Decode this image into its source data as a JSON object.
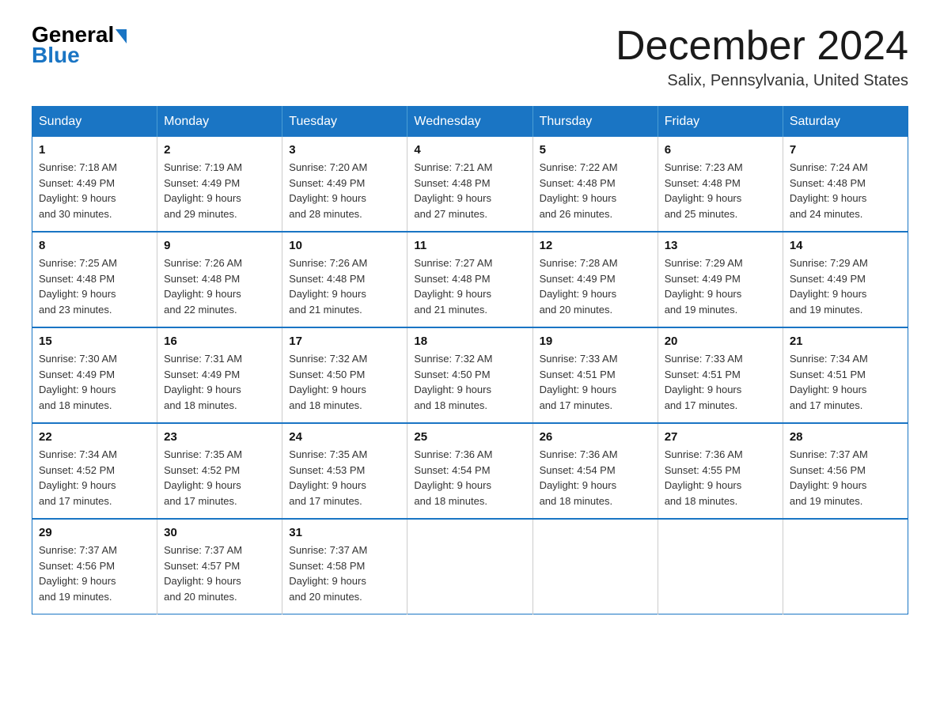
{
  "header": {
    "logo_general": "General",
    "logo_blue": "Blue",
    "month_title": "December 2024",
    "location": "Salix, Pennsylvania, United States"
  },
  "weekdays": [
    "Sunday",
    "Monday",
    "Tuesday",
    "Wednesday",
    "Thursday",
    "Friday",
    "Saturday"
  ],
  "weeks": [
    [
      {
        "day": "1",
        "sunrise": "7:18 AM",
        "sunset": "4:49 PM",
        "daylight": "9 hours and 30 minutes."
      },
      {
        "day": "2",
        "sunrise": "7:19 AM",
        "sunset": "4:49 PM",
        "daylight": "9 hours and 29 minutes."
      },
      {
        "day": "3",
        "sunrise": "7:20 AM",
        "sunset": "4:49 PM",
        "daylight": "9 hours and 28 minutes."
      },
      {
        "day": "4",
        "sunrise": "7:21 AM",
        "sunset": "4:48 PM",
        "daylight": "9 hours and 27 minutes."
      },
      {
        "day": "5",
        "sunrise": "7:22 AM",
        "sunset": "4:48 PM",
        "daylight": "9 hours and 26 minutes."
      },
      {
        "day": "6",
        "sunrise": "7:23 AM",
        "sunset": "4:48 PM",
        "daylight": "9 hours and 25 minutes."
      },
      {
        "day": "7",
        "sunrise": "7:24 AM",
        "sunset": "4:48 PM",
        "daylight": "9 hours and 24 minutes."
      }
    ],
    [
      {
        "day": "8",
        "sunrise": "7:25 AM",
        "sunset": "4:48 PM",
        "daylight": "9 hours and 23 minutes."
      },
      {
        "day": "9",
        "sunrise": "7:26 AM",
        "sunset": "4:48 PM",
        "daylight": "9 hours and 22 minutes."
      },
      {
        "day": "10",
        "sunrise": "7:26 AM",
        "sunset": "4:48 PM",
        "daylight": "9 hours and 21 minutes."
      },
      {
        "day": "11",
        "sunrise": "7:27 AM",
        "sunset": "4:48 PM",
        "daylight": "9 hours and 21 minutes."
      },
      {
        "day": "12",
        "sunrise": "7:28 AM",
        "sunset": "4:49 PM",
        "daylight": "9 hours and 20 minutes."
      },
      {
        "day": "13",
        "sunrise": "7:29 AM",
        "sunset": "4:49 PM",
        "daylight": "9 hours and 19 minutes."
      },
      {
        "day": "14",
        "sunrise": "7:29 AM",
        "sunset": "4:49 PM",
        "daylight": "9 hours and 19 minutes."
      }
    ],
    [
      {
        "day": "15",
        "sunrise": "7:30 AM",
        "sunset": "4:49 PM",
        "daylight": "9 hours and 18 minutes."
      },
      {
        "day": "16",
        "sunrise": "7:31 AM",
        "sunset": "4:49 PM",
        "daylight": "9 hours and 18 minutes."
      },
      {
        "day": "17",
        "sunrise": "7:32 AM",
        "sunset": "4:50 PM",
        "daylight": "9 hours and 18 minutes."
      },
      {
        "day": "18",
        "sunrise": "7:32 AM",
        "sunset": "4:50 PM",
        "daylight": "9 hours and 18 minutes."
      },
      {
        "day": "19",
        "sunrise": "7:33 AM",
        "sunset": "4:51 PM",
        "daylight": "9 hours and 17 minutes."
      },
      {
        "day": "20",
        "sunrise": "7:33 AM",
        "sunset": "4:51 PM",
        "daylight": "9 hours and 17 minutes."
      },
      {
        "day": "21",
        "sunrise": "7:34 AM",
        "sunset": "4:51 PM",
        "daylight": "9 hours and 17 minutes."
      }
    ],
    [
      {
        "day": "22",
        "sunrise": "7:34 AM",
        "sunset": "4:52 PM",
        "daylight": "9 hours and 17 minutes."
      },
      {
        "day": "23",
        "sunrise": "7:35 AM",
        "sunset": "4:52 PM",
        "daylight": "9 hours and 17 minutes."
      },
      {
        "day": "24",
        "sunrise": "7:35 AM",
        "sunset": "4:53 PM",
        "daylight": "9 hours and 17 minutes."
      },
      {
        "day": "25",
        "sunrise": "7:36 AM",
        "sunset": "4:54 PM",
        "daylight": "9 hours and 18 minutes."
      },
      {
        "day": "26",
        "sunrise": "7:36 AM",
        "sunset": "4:54 PM",
        "daylight": "9 hours and 18 minutes."
      },
      {
        "day": "27",
        "sunrise": "7:36 AM",
        "sunset": "4:55 PM",
        "daylight": "9 hours and 18 minutes."
      },
      {
        "day": "28",
        "sunrise": "7:37 AM",
        "sunset": "4:56 PM",
        "daylight": "9 hours and 19 minutes."
      }
    ],
    [
      {
        "day": "29",
        "sunrise": "7:37 AM",
        "sunset": "4:56 PM",
        "daylight": "9 hours and 19 minutes."
      },
      {
        "day": "30",
        "sunrise": "7:37 AM",
        "sunset": "4:57 PM",
        "daylight": "9 hours and 20 minutes."
      },
      {
        "day": "31",
        "sunrise": "7:37 AM",
        "sunset": "4:58 PM",
        "daylight": "9 hours and 20 minutes."
      },
      null,
      null,
      null,
      null
    ]
  ],
  "labels": {
    "sunrise": "Sunrise:",
    "sunset": "Sunset:",
    "daylight": "Daylight:"
  }
}
